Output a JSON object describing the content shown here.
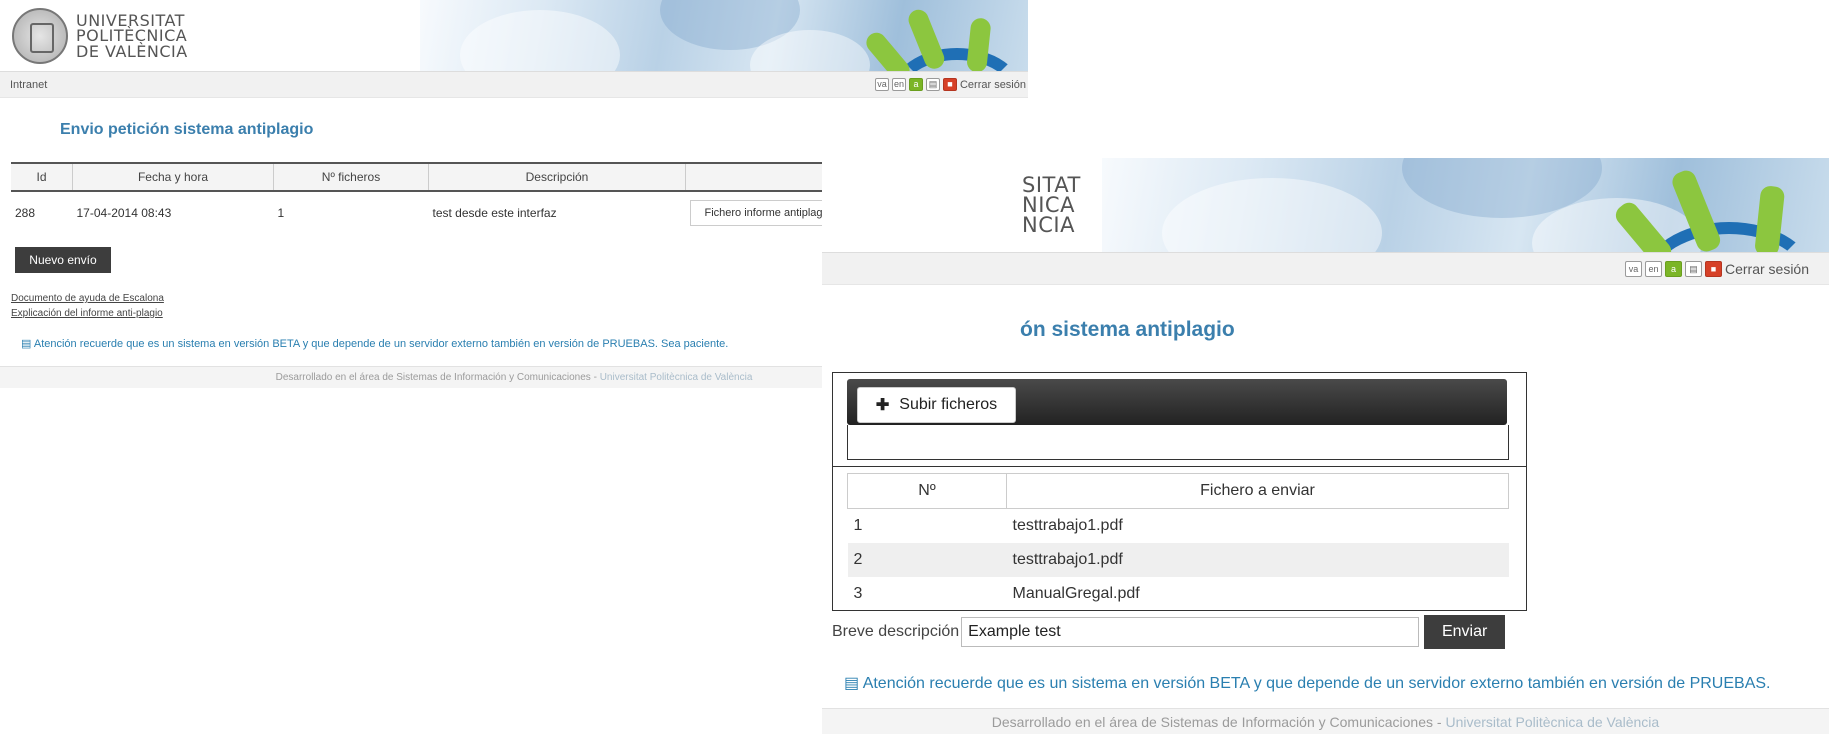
{
  "colors": {
    "accent": "#3b7fad",
    "dark_button": "#3d3d3d",
    "notice": "#2a7fb0"
  },
  "logo": {
    "line1": "UNIVERSITAT",
    "line2": "POLITÈCNICA",
    "line3": "DE VALÈNCIA"
  },
  "partial_logo": {
    "line1": "SITAT",
    "line2": "NICA",
    "line3": "NCIA"
  },
  "topbar": {
    "section": "Intranet",
    "icons": [
      "va",
      "en",
      "a",
      "calendar-icon",
      "lock-icon"
    ],
    "lang_va": "va",
    "lang_en": "en",
    "lang_es": "a",
    "logout": "Cerrar sesión"
  },
  "panel_a": {
    "title": "Envio petición sistema antiplagio",
    "table": {
      "headers": [
        "Id",
        "Fecha y hora",
        "Nº ficheros",
        "Descripción",
        ""
      ],
      "rows": [
        {
          "id": "288",
          "date": "17-04-2014 08:43",
          "files": "1",
          "description": "test desde este interfaz",
          "action": "Fichero informe antiplagio"
        }
      ]
    },
    "new_button": "Nuevo envío",
    "links": [
      "Documento de ayuda de Escalona",
      "Explicación del informe anti-plagio"
    ],
    "notice": "Atención recuerde que es un sistema en versión BETA y que depende de un servidor externo también en versión de PRUEBAS. Sea paciente.",
    "footer_main": "Desarrollado en el área de Sistemas de Información y Comunicaciones",
    "footer_sep": "-",
    "footer_uni": "Universitat Politècnica de València"
  },
  "panel_b": {
    "title_partial": "ón sistema antiplagio",
    "upload_button": "Subir ficheros",
    "files_table": {
      "headers": [
        "Nº",
        "Fichero a enviar"
      ],
      "rows": [
        {
          "n": "1",
          "file": "testtrabajo1.pdf"
        },
        {
          "n": "2",
          "file": "testtrabajo1.pdf"
        },
        {
          "n": "3",
          "file": "ManualGregal.pdf"
        }
      ]
    },
    "description_label": "Breve descripción",
    "description_value": "Example test",
    "send_button": "Enviar",
    "notice": "Atención recuerde que es un sistema en versión BETA y que depende de un servidor externo también en versión de PRUEBAS.",
    "footer_main": "Desarrollado en el área de Sistemas de Información y Comunicaciones",
    "footer_sep": "-",
    "footer_uni": "Universitat Politècnica de València"
  }
}
